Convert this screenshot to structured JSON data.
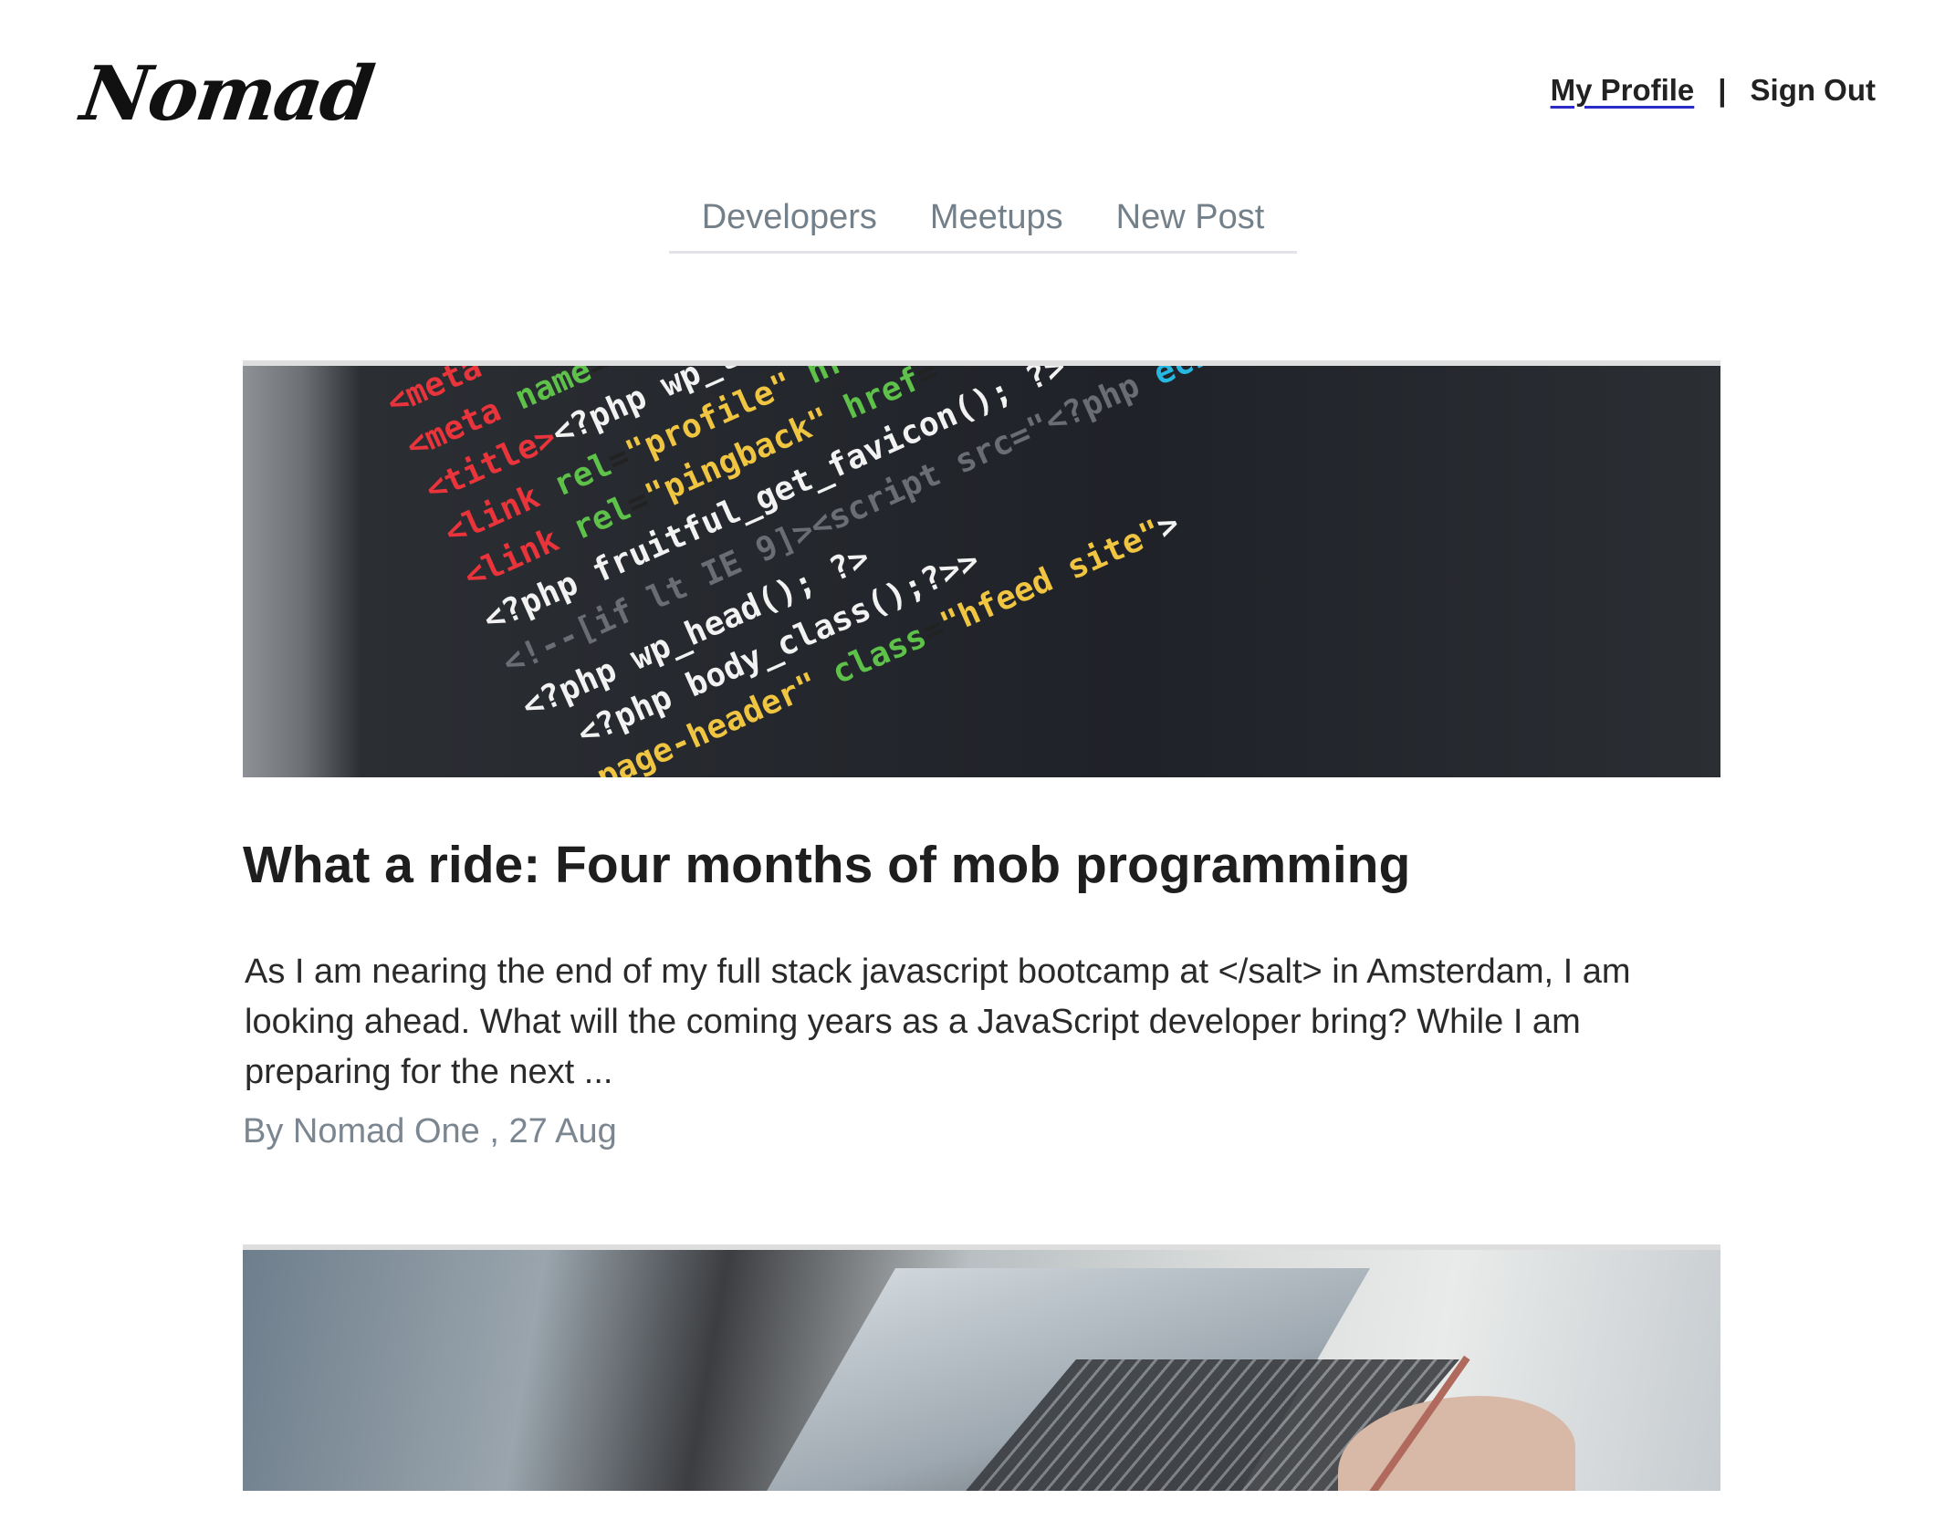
{
  "header": {
    "logo": "Nomad",
    "profile_link": "My Profile",
    "separator": "|",
    "signout_link": "Sign Out"
  },
  "nav": {
    "items": [
      {
        "label": "Developers"
      },
      {
        "label": "Meetups"
      },
      {
        "label": "New Post"
      }
    ]
  },
  "posts": [
    {
      "title": "What a ride: Four months of mob programming",
      "excerpt": "As I am nearing the end of my full stack javascript bootcamp at </salt> in Amsterdam, I am looking ahead. What will the coming years as a JavaScript developer bring? While I am preparing for the next ...",
      "author": "Nomad One",
      "date": "27 Aug",
      "meta": "By Nomad One , 27 Aug",
      "image": "code-editor-photo"
    },
    {
      "image": "laptop-desk-photo"
    }
  ],
  "colors": {
    "nav_text": "#748089",
    "meta_text": "#7b8690",
    "profile_underline": "#2b2bc9",
    "nav_border": "#e1e3e6"
  }
}
